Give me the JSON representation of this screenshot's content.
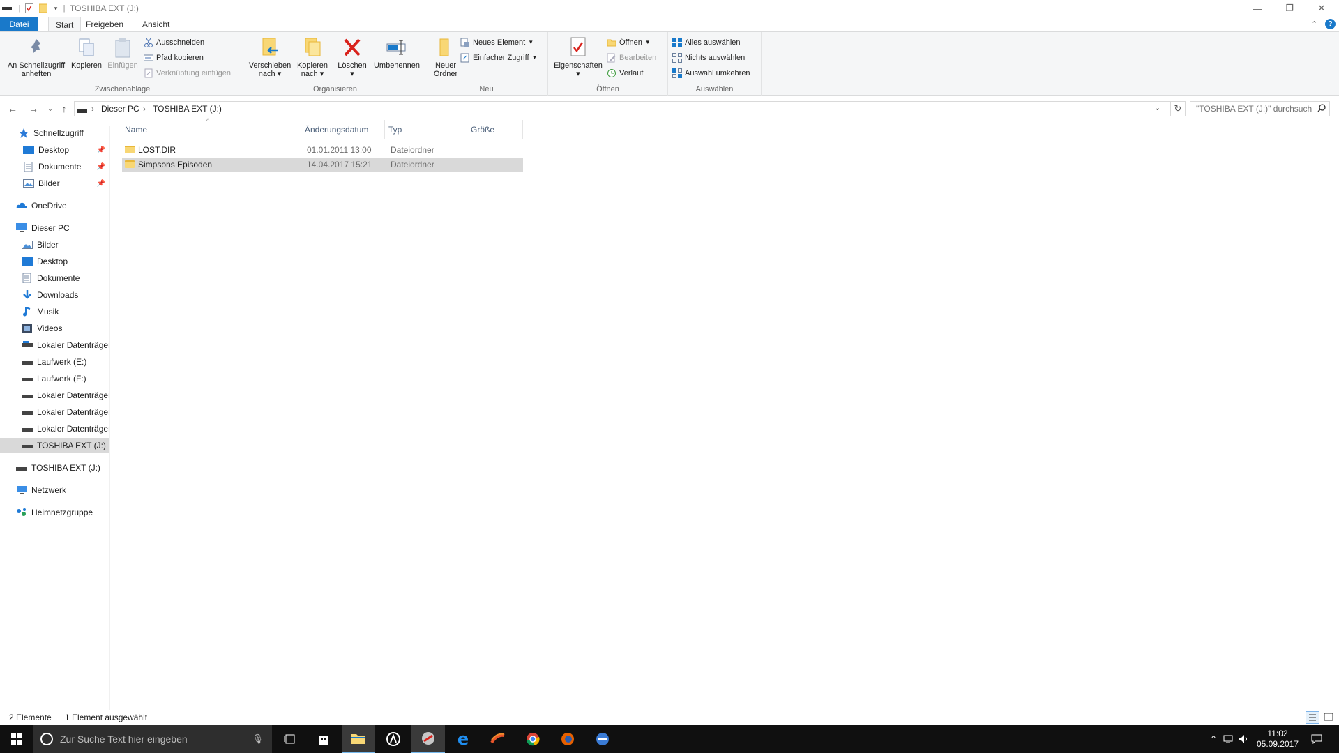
{
  "window": {
    "title": "TOSHIBA EXT (J:)",
    "controls": {
      "minimize": "—",
      "maximize": "❐",
      "close": "✕"
    }
  },
  "tabs": {
    "file": "Datei",
    "start": "Start",
    "share": "Freigeben",
    "view": "Ansicht"
  },
  "ribbon": {
    "clipboard": {
      "label": "Zwischenablage",
      "pin_line1": "An Schnellzugriff",
      "pin_line2": "anheften",
      "copy": "Kopieren",
      "paste": "Einfügen",
      "cut": "Ausschneiden",
      "copy_path": "Pfad kopieren",
      "paste_shortcut": "Verknüpfung einfügen"
    },
    "organize": {
      "label": "Organisieren",
      "move_line1": "Verschieben",
      "move_line2": "nach",
      "copyto_line1": "Kopieren",
      "copyto_line2": "nach",
      "delete": "Löschen",
      "rename": "Umbenennen"
    },
    "new": {
      "label": "Neu",
      "folder_line1": "Neuer",
      "folder_line2": "Ordner",
      "new_item": "Neues Element",
      "easy_access": "Einfacher Zugriff"
    },
    "open": {
      "label": "Öffnen",
      "properties": "Eigenschaften",
      "open": "Öffnen",
      "edit": "Bearbeiten",
      "history": "Verlauf"
    },
    "select": {
      "label": "Auswählen",
      "select_all": "Alles auswählen",
      "select_none": "Nichts auswählen",
      "invert": "Auswahl umkehren"
    }
  },
  "address": {
    "crumbs": [
      "Dieser PC",
      "TOSHIBA EXT (J:)"
    ],
    "search_placeholder": "\"TOSHIBA EXT (J:)\" durchsuch..."
  },
  "nav": {
    "quick_access": "Schnellzugriff",
    "qa_items": [
      "Desktop",
      "Dokumente",
      "Bilder"
    ],
    "onedrive": "OneDrive",
    "this_pc": "Dieser PC",
    "pc_items": [
      "Bilder",
      "Desktop",
      "Dokumente",
      "Downloads",
      "Musik",
      "Videos",
      "Lokaler Datenträger",
      "Laufwerk (E:)",
      "Laufwerk (F:)",
      "Lokaler Datenträger",
      "Lokaler Datenträger",
      "Lokaler Datenträger",
      "TOSHIBA EXT (J:)"
    ],
    "drive_root": "TOSHIBA EXT (J:)",
    "network": "Netzwerk",
    "homegroup": "Heimnetzgruppe"
  },
  "columns": {
    "name": "Name",
    "date": "Änderungsdatum",
    "type": "Typ",
    "size": "Größe"
  },
  "files": [
    {
      "name": "LOST.DIR",
      "date": "01.01.2011 13:00",
      "type": "Dateiordner"
    },
    {
      "name": "Simpsons Episoden",
      "date": "14.04.2017 15:21",
      "type": "Dateiordner"
    }
  ],
  "status": {
    "count": "2 Elemente",
    "selection": "1 Element ausgewählt"
  },
  "taskbar": {
    "search_placeholder": "Zur Suche Text hier eingeben",
    "time": "11:02",
    "date": "05.09.2017"
  },
  "colors": {
    "accent": "#1979ca",
    "selection": "#d9d9d9",
    "folder": "#f8d775",
    "delete": "#d9221c"
  }
}
